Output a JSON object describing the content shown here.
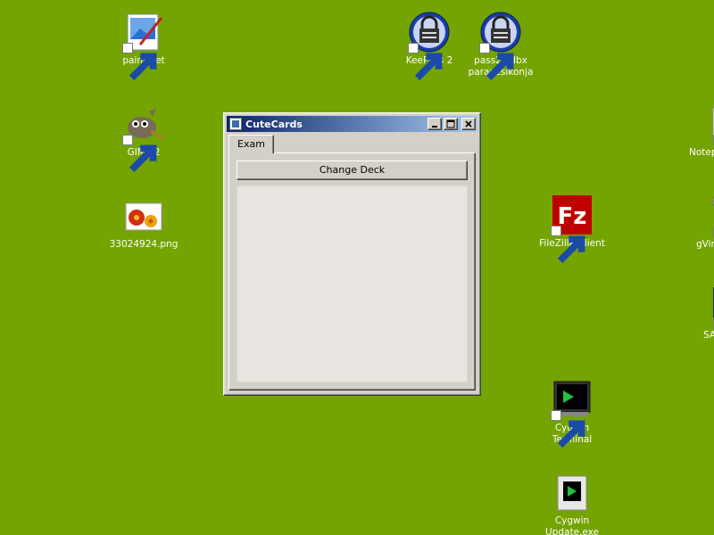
{
  "desktop": {
    "background": "#74a402",
    "icons": [
      {
        "label": "paint.net",
        "icon": "paintnet-icon"
      },
      {
        "label": "GIMP 2",
        "icon": "gimp-icon"
      },
      {
        "label": "33024924.png",
        "icon": "image-file-icon"
      },
      {
        "label": "KeePass 2",
        "icon": "keepass-lock-icon"
      },
      {
        "label": "pass2.kdbx\nparancsikonja",
        "icon": "keepass-lock-icon"
      },
      {
        "label": "FileZilla Client",
        "icon": "filezilla-icon"
      },
      {
        "label": "Cygwin\nTerminal",
        "icon": "cygwin-terminal-icon"
      },
      {
        "label": "Cygwin\nUpdate.exe",
        "icon": "cygwin-update-icon"
      },
      {
        "label": "Notep",
        "icon": "notepad-plus-icon"
      },
      {
        "label": "gVim",
        "icon": "gvim-icon"
      },
      {
        "label": "SA",
        "icon": "app-icon"
      }
    ]
  },
  "window": {
    "title": "CuteCards",
    "tabs": [
      {
        "label": "Exam"
      }
    ],
    "change_deck_label": "Change Deck",
    "accent": "#0a246a"
  }
}
